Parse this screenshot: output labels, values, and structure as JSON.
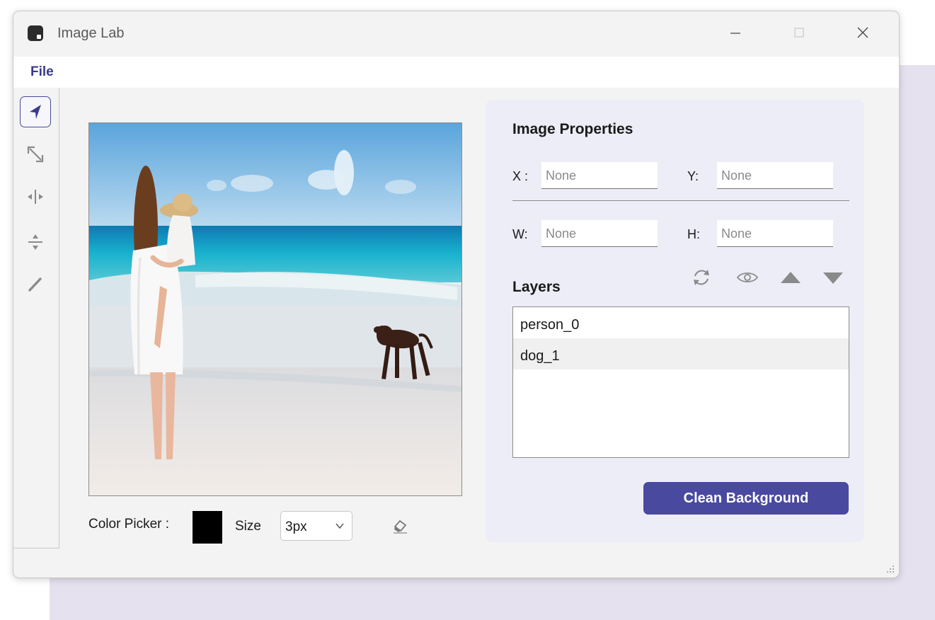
{
  "window": {
    "title": "Image Lab"
  },
  "menu": {
    "file": "File"
  },
  "toolbar": {
    "tools": [
      {
        "name": "select-arrow-icon",
        "active": true
      },
      {
        "name": "resize-diagonal-icon",
        "active": false
      },
      {
        "name": "resize-horizontal-icon",
        "active": false
      },
      {
        "name": "resize-vertical-icon",
        "active": false
      },
      {
        "name": "pencil-icon",
        "active": false
      }
    ]
  },
  "bottom": {
    "color_picker_label": "Color Picker :",
    "color_value": "#000000",
    "size_label": "Size",
    "size_value": "3px"
  },
  "properties": {
    "title": "Image Properties",
    "x_label": "X :",
    "x_placeholder": "None",
    "y_label": "Y:",
    "y_placeholder": "None",
    "w_label": "W:",
    "w_placeholder": "None",
    "h_label": "H:",
    "h_placeholder": "None"
  },
  "layers": {
    "title": "Layers",
    "items": [
      "person_0",
      "dog_1"
    ],
    "selected_index": 1
  },
  "actions": {
    "clean_background": "Clean Background"
  },
  "colors": {
    "accent": "#4a49a0",
    "panel": "#ededf8",
    "backdrop": "#e6e1ee"
  }
}
